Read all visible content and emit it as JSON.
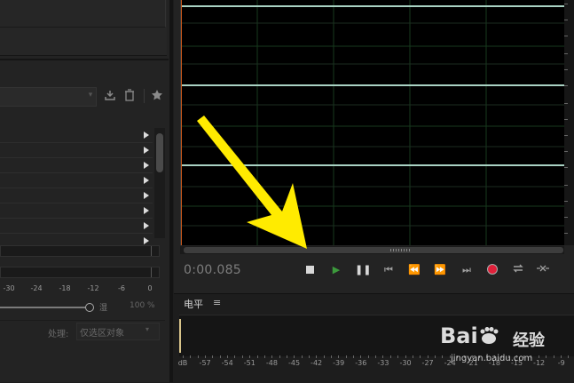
{
  "left_panel": {
    "list_row_count": 8,
    "meter_scale": [
      "-30",
      "-24",
      "-18",
      "-12",
      "-6",
      "0"
    ],
    "slider_mark": "湿",
    "wet_percent": "100 %",
    "process_label": "处理:",
    "process_value": "仅选区对象"
  },
  "editor": {
    "time": "0:00.085",
    "transport": {
      "stop": "stop-icon",
      "play": "play-icon",
      "pause": "pause-icon",
      "goto_start": "skip-to-start-icon",
      "rewind": "rewind-icon",
      "fast_forward": "fast-forward-icon",
      "goto_end": "skip-to-end-icon",
      "record": "record-icon",
      "loop": "loop-icon",
      "skip": "skip-selection-icon"
    },
    "colors": {
      "playhead": "#c8561a",
      "record": "#e0203a",
      "waveform_line": "#a9d2c3"
    }
  },
  "level_panel": {
    "title": "电平",
    "menu_icon": "≡",
    "scale": [
      "dB",
      "-57",
      "-54",
      "-51",
      "-48",
      "-45",
      "-42",
      "-39",
      "-36",
      "-33",
      "-30",
      "-27",
      "-24",
      "-21",
      "-18",
      "-15",
      "-12",
      "-9"
    ]
  },
  "watermark": {
    "logo": "Bai",
    "logo_tail": "百",
    "text": "经验",
    "url": "jingyan.baidu.com"
  }
}
